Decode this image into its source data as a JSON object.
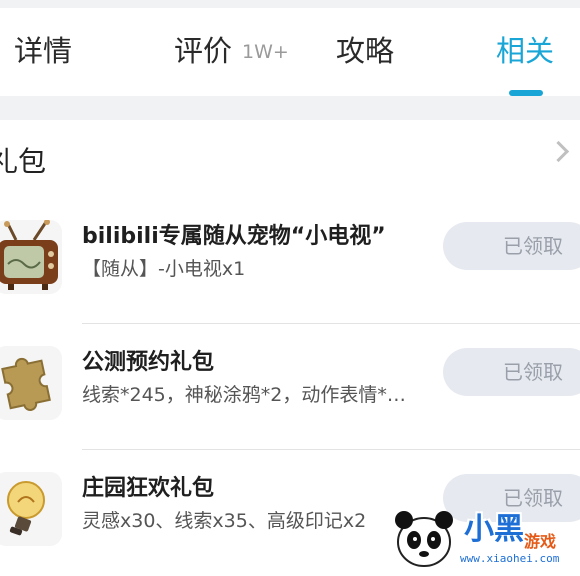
{
  "tabs": [
    {
      "label": "详情",
      "badge": ""
    },
    {
      "label": "评价",
      "badge": "1W+"
    },
    {
      "label": "攻略",
      "badge": ""
    },
    {
      "label": "相关",
      "badge": "",
      "active": true
    }
  ],
  "section": {
    "title": "礼包"
  },
  "gifts": [
    {
      "name": "bilibili专属随从宠物“小电视”",
      "desc": "【随从】-小电视x1",
      "button": "已领取",
      "icon": "tv-icon"
    },
    {
      "name": "公测预约礼包",
      "desc": "线索*245，神秘涂鸦*2，动作表情*…",
      "button": "已领取",
      "icon": "puzzle-piece-icon"
    },
    {
      "name": "庄园狂欢礼包",
      "desc": "灵感x30、线索x35、高级印记x2",
      "button": "已领取",
      "icon": "lightbulb-icon"
    }
  ],
  "watermark": {
    "brand": "小黑",
    "sub": "游戏",
    "url": "www.xiaohei.com"
  },
  "colors": {
    "accent": "#19a6d6",
    "claimed_bg": "#e6e9ef"
  }
}
